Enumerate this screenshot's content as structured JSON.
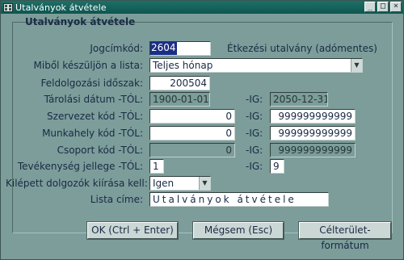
{
  "window": {
    "title": "Utalványok átvétele",
    "buttons": {
      "minimize": "_",
      "maximize": "□",
      "close": "×"
    }
  },
  "panel": {
    "title": "Utalványok átvétele"
  },
  "form": {
    "jogcimkod": {
      "label": "Jogcímkód:",
      "value": "2604",
      "description": "Étkezési utalvány (adómentes)"
    },
    "mibol": {
      "label": "Miből készüljön a lista:",
      "value": "Teljes hónap"
    },
    "idoszak": {
      "label": "Feldolgozási időszak:",
      "value": "200504"
    },
    "tarolasi": {
      "label": "Tárolási dátum -TÓL:",
      "from": "1900-01-01",
      "ig_label": "-IG:",
      "to": "2050-12-31"
    },
    "szervezet": {
      "label": "Szervezet kód -TÓL:",
      "from": "0",
      "ig_label": "-IG:",
      "to": "999999999999"
    },
    "munkahely": {
      "label": "Munkahely kód -TÓL:",
      "from": "0",
      "ig_label": "-IG:",
      "to": "999999999999"
    },
    "csoport": {
      "label": "Csoport kód -TÓL:",
      "from": "0",
      "ig_label": "-IG:",
      "to": "999999999999"
    },
    "tevekenyseg": {
      "label": "Tevékenység jellege -TÓL:",
      "from": "1",
      "ig_label": "-IG:",
      "to": "9"
    },
    "kilepett": {
      "label": "Kilépett dolgozók kiírása kell:",
      "value": "Igen"
    },
    "lista_cime": {
      "label": "Lista címe:",
      "value": "Utalványok átvétele"
    }
  },
  "buttons": {
    "ok": "OK (Ctrl + Enter)",
    "cancel": "Mégsem (Esc)",
    "target": "Célterület-formátum"
  }
}
